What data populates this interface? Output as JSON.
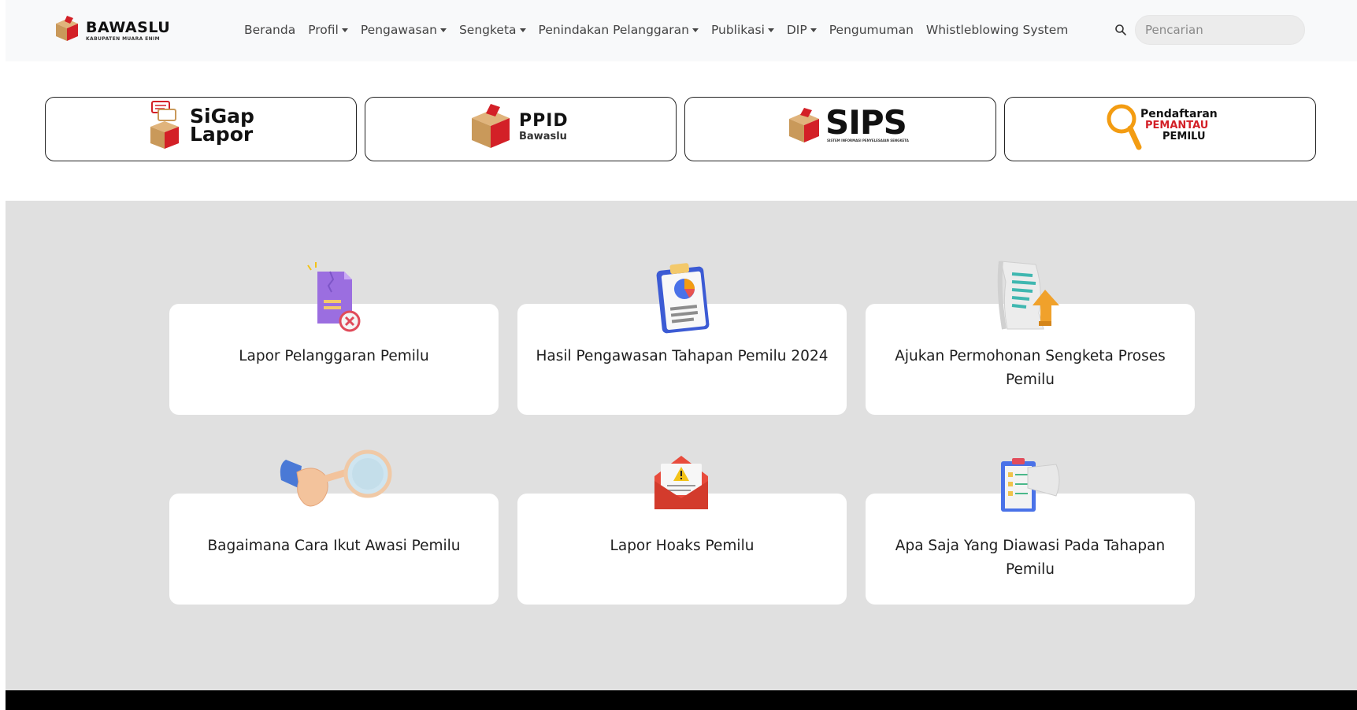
{
  "navbar": {
    "logo": {
      "brand": "BAWASLU",
      "subtitle": "KABUPATEN MUARA ENIM"
    },
    "menu": [
      {
        "label": "Beranda",
        "dropdown": false
      },
      {
        "label": "Profil",
        "dropdown": true
      },
      {
        "label": "Pengawasan",
        "dropdown": true
      },
      {
        "label": "Sengketa",
        "dropdown": true
      },
      {
        "label": "Penindakan Pelanggaran",
        "dropdown": true
      },
      {
        "label": "Publikasi",
        "dropdown": true
      },
      {
        "label": "DIP",
        "dropdown": true
      },
      {
        "label": "Pengumuman",
        "dropdown": false
      },
      {
        "label": "Whistleblowing System",
        "dropdown": false
      }
    ],
    "search": {
      "placeholder": "Pencarian"
    }
  },
  "banners": {
    "sigap": {
      "line1": "SiGap",
      "line2": "Lapor"
    },
    "ppid": {
      "line1": "PPID",
      "line2": "Bawaslu"
    },
    "sips": {
      "line1": "SIPS",
      "line2": "SISTEM INFORMASI PENYELESAIAN SENGKETA"
    },
    "pemantau": {
      "line1": "Pendaftaran",
      "line2": "PEMANTAU",
      "line3": "PEMILU"
    }
  },
  "cards": [
    {
      "label": "Lapor Pelanggaran Pemilu",
      "icon": "document-reject-icon"
    },
    {
      "label": "Hasil Pengawasan Tahapan Pemilu 2024",
      "icon": "clipboard-chart-icon"
    },
    {
      "label": "Ajukan Permohonan Sengketa Proses Pemilu",
      "icon": "scroll-upload-icon"
    },
    {
      "label": "Bagaimana Cara Ikut Awasi Pemilu",
      "icon": "magnifier-hand-icon"
    },
    {
      "label": "Lapor Hoaks Pemilu",
      "icon": "warning-envelope-icon"
    },
    {
      "label": "Apa Saja Yang Diawasi Pada Tahapan Pemilu",
      "icon": "checklist-megaphone-icon"
    }
  ],
  "colors": {
    "brand_red": "#d32027",
    "brand_gold": "#c9995a",
    "accent_orange": "#f39c12"
  }
}
